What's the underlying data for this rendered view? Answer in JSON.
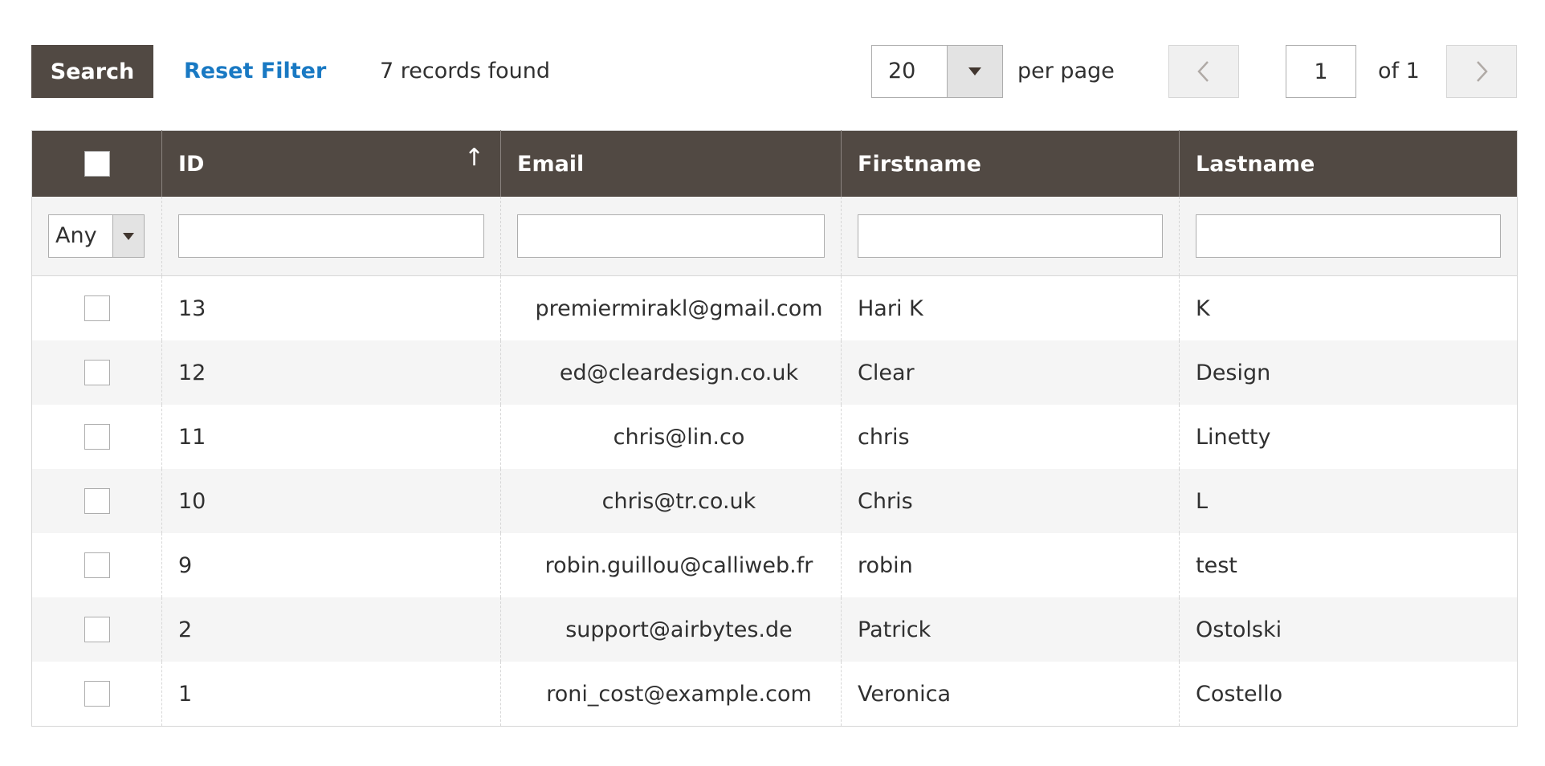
{
  "toolbar": {
    "search_label": "Search",
    "reset_label": "Reset Filter",
    "records_text": "7 records found",
    "per_page_value": "20",
    "per_page_label": "per page",
    "current_page": "1",
    "of_pages": "of 1"
  },
  "grid": {
    "columns": {
      "id": "ID",
      "email": "Email",
      "firstname": "Firstname",
      "lastname": "Lastname"
    },
    "sort_indicator": "↑",
    "filters": {
      "any_value": "Any",
      "id": "",
      "email": "",
      "firstname": "",
      "lastname": ""
    },
    "rows": [
      {
        "id": "13",
        "email": "premiermirakl@gmail.com",
        "firstname": "Hari K",
        "lastname": "K"
      },
      {
        "id": "12",
        "email": "ed@cleardesign.co.uk",
        "firstname": "Clear",
        "lastname": "Design"
      },
      {
        "id": "11",
        "email": "chris@lin.co",
        "firstname": "chris",
        "lastname": "Linetty"
      },
      {
        "id": "10",
        "email": "chris@tr.co.uk",
        "firstname": "Chris",
        "lastname": "L"
      },
      {
        "id": "9",
        "email": "robin.guillou@calliweb.fr",
        "firstname": "robin",
        "lastname": "test"
      },
      {
        "id": "2",
        "email": "support@airbytes.de",
        "firstname": "Patrick",
        "lastname": "Ostolski"
      },
      {
        "id": "1",
        "email": "roni_cost@example.com",
        "firstname": "Veronica",
        "lastname": "Costello"
      }
    ]
  },
  "icons": {
    "prev": "chevron-left-icon",
    "next": "chevron-right-icon",
    "dropdown": "caret-down-icon"
  },
  "colors": {
    "header_bg": "#514943",
    "link": "#1979c3",
    "stripe": "#f5f5f5"
  }
}
